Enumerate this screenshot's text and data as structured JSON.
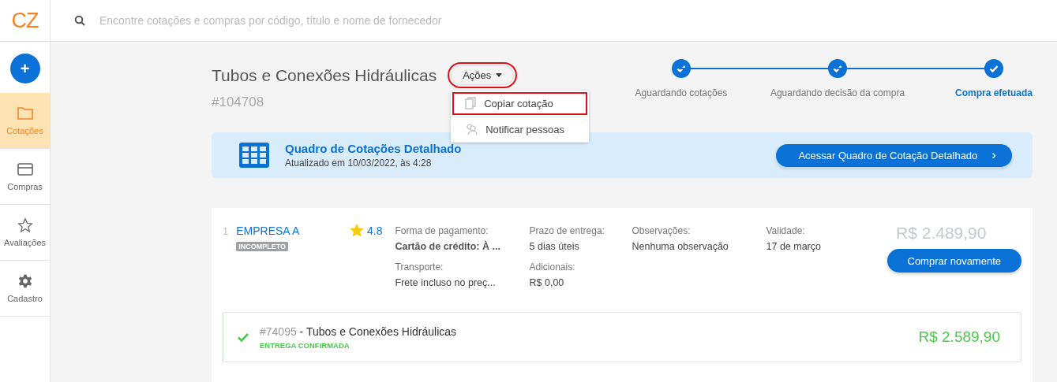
{
  "logo": "CZ",
  "search": {
    "placeholder": "Encontre cotações e compras por código, título e nome de fornecedor"
  },
  "new_button": {
    "label": "+"
  },
  "sidebar": {
    "items": [
      {
        "label": "Cotações",
        "selected": true
      },
      {
        "label": "Compras",
        "selected": false
      },
      {
        "label": "Avaliações",
        "selected": false
      },
      {
        "label": "Cadastro",
        "selected": false
      }
    ]
  },
  "quote": {
    "title": "Tubos e Conexões Hidráulicas",
    "id": "#104708"
  },
  "actions": {
    "label": "Ações",
    "highlighted": true,
    "expanded": true,
    "menu": [
      {
        "label": "Copiar cotação",
        "highlighted": true
      },
      {
        "label": "Notificar pessoas",
        "highlighted": false
      }
    ]
  },
  "steps": [
    {
      "label": "Aguardando cotações",
      "done": true,
      "current": false
    },
    {
      "label": "Aguardando decisão da compra",
      "done": true,
      "current": false
    },
    {
      "label": "Compra efetuada",
      "done": true,
      "current": true
    }
  ],
  "banner": {
    "title": "Quadro de Cotações Detalhado",
    "subtitle": "Atualizado em 10/03/2022, às 4:28",
    "button": "Acessar Quadro de Cotação Detalhado",
    "chevron": "›"
  },
  "offer": {
    "index": "1",
    "supplier": "EMPRESA A",
    "badge": "INCOMPLETO",
    "rating": "4.8",
    "fields": [
      {
        "label": "Forma de pagamento:",
        "value": "Cartão de crédito: À ...",
        "bold": true
      },
      {
        "label": "Prazo de entrega:",
        "value": "5 dias úteis",
        "bold": false
      },
      {
        "label": "Observações:",
        "value": "Nenhuma observação",
        "bold": false
      },
      {
        "label": "Validade:",
        "value": "17 de março",
        "bold": false
      },
      {
        "label": "Transporte:",
        "value": "Frete incluso no preç...",
        "bold": false
      },
      {
        "label": "Adicionais:",
        "value": "R$ 0,00",
        "bold": false
      }
    ],
    "price": "R$ 2.489,90",
    "button": "Comprar novamente",
    "purchase": {
      "code": "#74095",
      "title": "- Tubos e Conexões Hidráulicas",
      "status": "ENTREGA CONFIRMADA",
      "confirmed": true,
      "price": "R$ 2.589,90"
    }
  }
}
